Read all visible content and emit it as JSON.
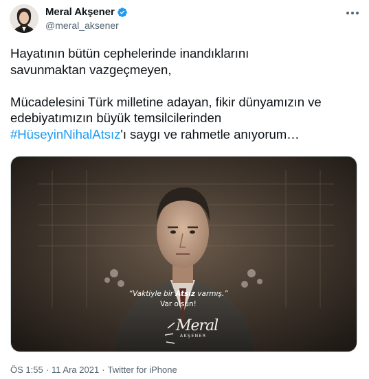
{
  "author": {
    "name": "Meral Akşener",
    "handle": "@meral_aksener",
    "avatar_icon": "profile-photo",
    "verified_icon": "verified-badge-icon",
    "verified_color": "#1d9bf0"
  },
  "tweet": {
    "line1": "Hayatının bütün cephelerinde inandıklarını",
    "line2": "savunmaktan vazgeçmeyen,",
    "line3": "Mücadelesini Türk milletine adayan, fikir dünyamızın ve",
    "line4": "edebiyatımızın büyük temsilcilerinden",
    "hashtag": "#HüseyinNihalAtsız",
    "line5_rest": "'ı saygı ve rahmetle anıyorum…",
    "hashtag_color": "#1d9bf0"
  },
  "media": {
    "quote_open": "“Vaktiyle bir ",
    "quote_strong": "Atsız",
    "quote_close": " varmış.”",
    "quote_line2": "Var olsun!",
    "signature": "Meral",
    "signature_sub": "AKŞENER"
  },
  "meta": {
    "time": "ÖS 1:55",
    "dot1": "·",
    "date": "11 Ara 2021",
    "dot2": "·",
    "source": "Twitter for iPhone"
  },
  "menu": {
    "more_icon": "more-horizontal-icon"
  }
}
